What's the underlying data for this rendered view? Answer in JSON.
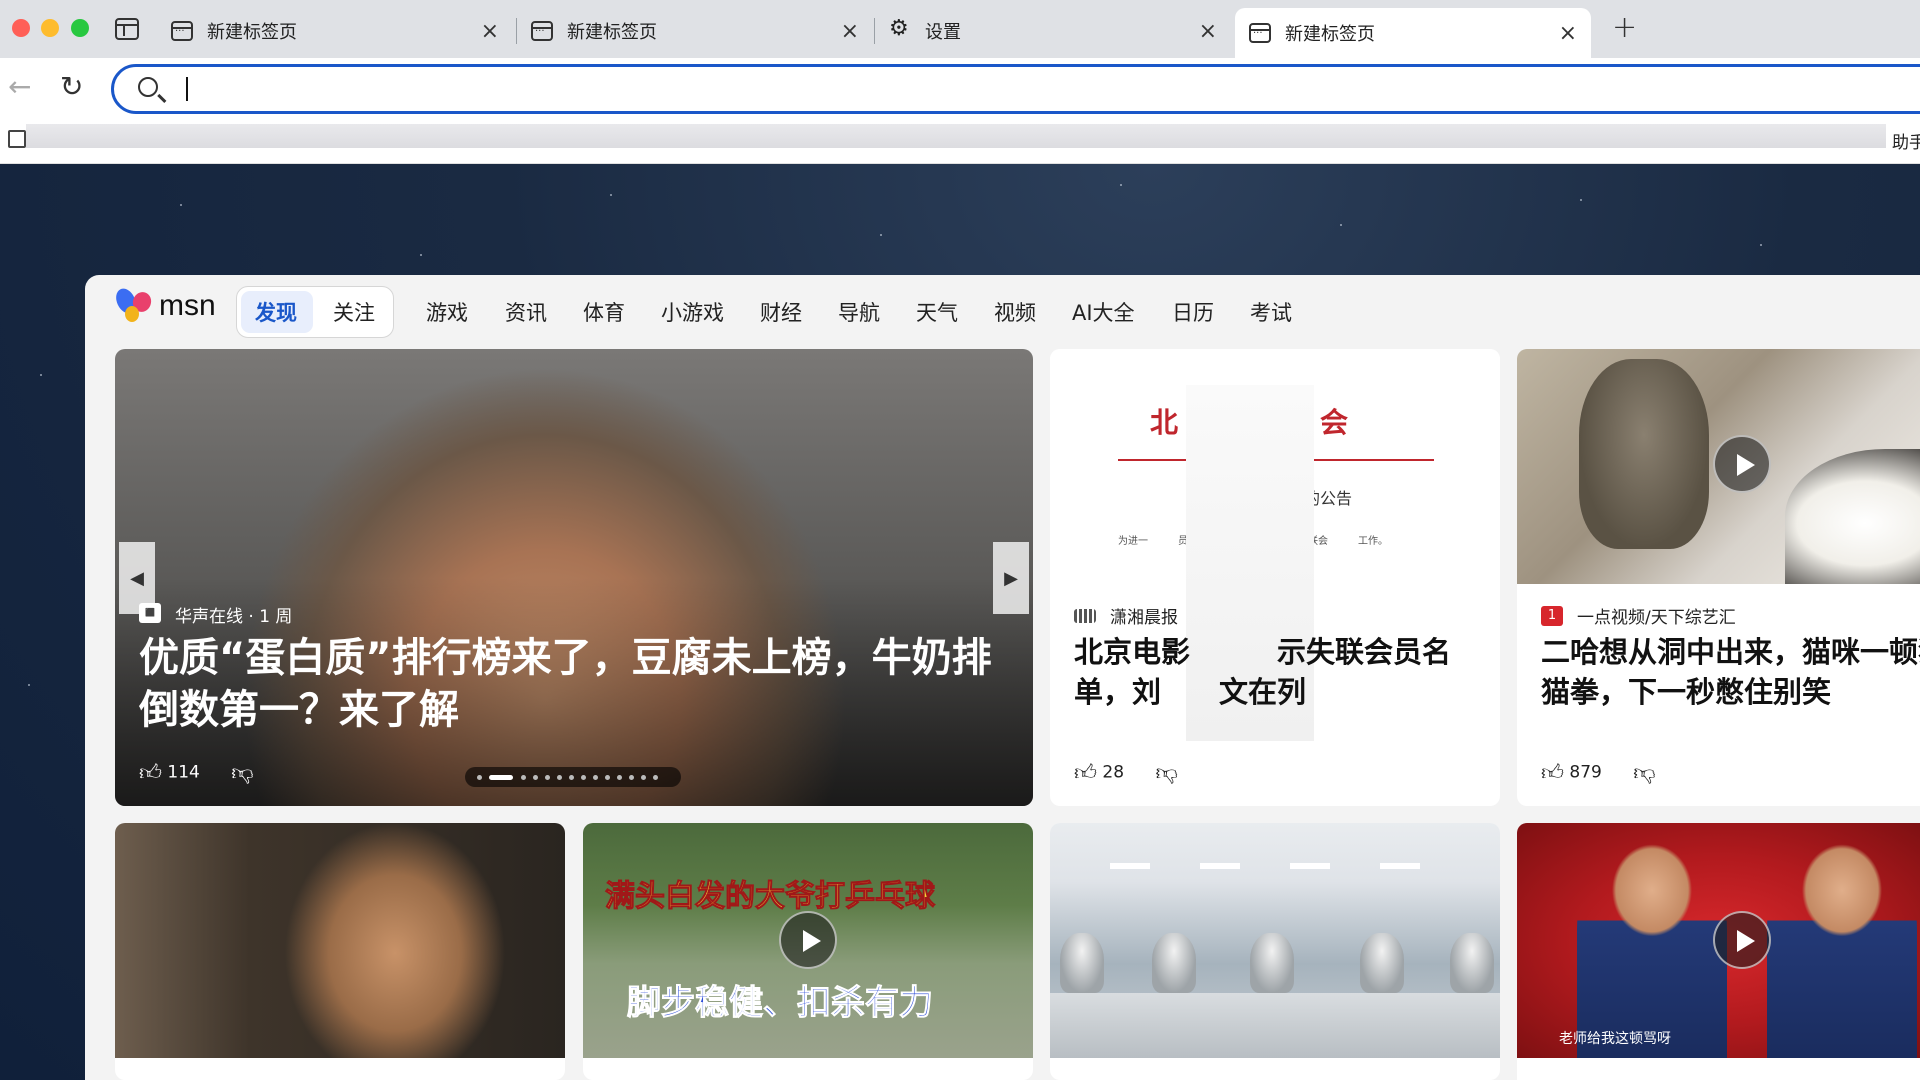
{
  "tabs": [
    {
      "title": "新建标签页",
      "close": "×"
    },
    {
      "title": "新建标签页",
      "close": "×"
    },
    {
      "title": "设置",
      "close": "×"
    },
    {
      "title": "新建标签页",
      "close": "×"
    }
  ],
  "new_tab_glyph": "+",
  "toolbar": {
    "back_glyph": "←",
    "reload_glyph": "↻"
  },
  "omnibox": {
    "value": "",
    "placeholder": ""
  },
  "bookmarks": {
    "right_label": "助手"
  },
  "msn": {
    "logo_text": "msn",
    "discover_label": "发现",
    "follow_label": "关注",
    "nav": [
      "游戏",
      "资讯",
      "体育",
      "小游戏",
      "财经",
      "导航",
      "天气",
      "视频",
      "AI大全",
      "日历",
      "考试"
    ]
  },
  "hero": {
    "source": "华声在线",
    "age": "· 1 周",
    "title": "优质“蛋白质”排行榜来了，豆腐未上榜，牛奶排倒数第一？来了解",
    "likes": "114",
    "arrow_left": "◀",
    "arrow_right": "▶"
  },
  "card_doc": {
    "doc_heading": "北　　　协会",
    "doc_sub": "的公告",
    "doc_body": "为进一　　　员信息档案，本协会现正对失联会　　　工作。",
    "source": "潇湘晨报",
    "title": "北京电影　　　示失联会员名单，刘　　文在列",
    "likes": "28"
  },
  "card_pets": {
    "source": "一点视频/天下综艺汇",
    "title": "二哈想从洞中出来，猫咪一顿猫猫拳，下一秒憋住别笑",
    "likes": "879"
  },
  "row2": {
    "pingpong_caption1": "满头白发的大爷打乒乓球",
    "pingpong_caption2": "脚步稳健、扣杀有力",
    "crosstalk_caption": "老师给我这顿骂呀"
  },
  "colors": {
    "accent": "#1a57c9",
    "msn_active": "#1a57c9",
    "red": "#c0262d"
  }
}
